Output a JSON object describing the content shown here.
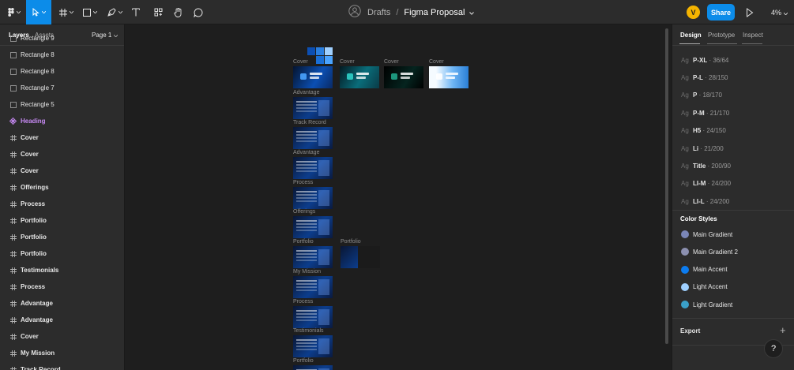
{
  "toolbar": {
    "file_title": "Figma Proposal",
    "location": "Drafts",
    "separator": "/",
    "user_initial": "V",
    "share_label": "Share",
    "zoom": "4%"
  },
  "left_panel": {
    "tabs": [
      "Layers",
      "Assets"
    ],
    "page": "Page 1",
    "layers": [
      {
        "name": "Rectangle 9",
        "kind": "rect"
      },
      {
        "name": "Rectangle 8",
        "kind": "rect"
      },
      {
        "name": "Rectangle 8",
        "kind": "rect"
      },
      {
        "name": "Rectangle 7",
        "kind": "rect"
      },
      {
        "name": "Rectangle 5",
        "kind": "rect"
      },
      {
        "name": "Heading",
        "kind": "component"
      },
      {
        "name": "Cover",
        "kind": "frame"
      },
      {
        "name": "Cover",
        "kind": "frame"
      },
      {
        "name": "Cover",
        "kind": "frame"
      },
      {
        "name": "Offerings",
        "kind": "frame"
      },
      {
        "name": "Process",
        "kind": "frame"
      },
      {
        "name": "Portfolio",
        "kind": "frame"
      },
      {
        "name": "Portfolio",
        "kind": "frame"
      },
      {
        "name": "Portfolio",
        "kind": "frame"
      },
      {
        "name": "Testimonials",
        "kind": "frame"
      },
      {
        "name": "Process",
        "kind": "frame"
      },
      {
        "name": "Advantage",
        "kind": "frame"
      },
      {
        "name": "Advantage",
        "kind": "frame"
      },
      {
        "name": "Cover",
        "kind": "frame"
      },
      {
        "name": "My Mission",
        "kind": "frame"
      },
      {
        "name": "Track Record",
        "kind": "frame"
      }
    ]
  },
  "canvas": {
    "frames": [
      {
        "label": "Cover",
        "style": "t-cover1"
      },
      {
        "label": "Cover",
        "style": "t-cover2"
      },
      {
        "label": "Cover",
        "style": "t-cover3"
      },
      {
        "label": "Cover",
        "style": "t-cover4"
      },
      {
        "label": "Advantage",
        "style": "t-dark"
      },
      {
        "label": "Track Record",
        "style": "t-dark"
      },
      {
        "label": "Advantage",
        "style": "t-dark"
      },
      {
        "label": "Process",
        "style": "t-dark"
      },
      {
        "label": "Offerings",
        "style": "t-dark"
      },
      {
        "label": "Portfolio",
        "style": "t-dark"
      },
      {
        "label": "Portfolio",
        "style": "t-grid"
      },
      {
        "label": "My Mission",
        "style": "t-dark"
      },
      {
        "label": "Process",
        "style": "t-dark"
      },
      {
        "label": "Testimonials",
        "style": "t-dark"
      },
      {
        "label": "Portfolio",
        "style": "t-dark"
      }
    ]
  },
  "right_panel": {
    "tabs": [
      "Design",
      "Prototype",
      "Inspect"
    ],
    "text_styles": [
      {
        "name": "P-XL",
        "spec": "36/64"
      },
      {
        "name": "P-L",
        "spec": "28/150"
      },
      {
        "name": "P",
        "spec": "18/170"
      },
      {
        "name": "P-M",
        "spec": "21/170"
      },
      {
        "name": "H5",
        "spec": "24/150"
      },
      {
        "name": "Li",
        "spec": "21/200"
      },
      {
        "name": "Title",
        "spec": "200/90"
      },
      {
        "name": "LI-M",
        "spec": "24/200"
      },
      {
        "name": "LI-L",
        "spec": "24/200"
      }
    ],
    "text_style_glyph": "Ag",
    "color_styles_title": "Color Styles",
    "color_styles": [
      {
        "name": "Main Gradient",
        "color": "#7a86b8"
      },
      {
        "name": "Main Gradient 2",
        "color": "#8c90b0"
      },
      {
        "name": "Main Accent",
        "color": "#0c7cf0"
      },
      {
        "name": "Light Accent",
        "color": "#9fd0ff"
      },
      {
        "name": "Light Gradient",
        "color": "#3aa0c8"
      }
    ],
    "export_label": "Export",
    "help_label": "?"
  },
  "colors": {
    "accent": "#0c8ce9",
    "panel": "#2c2c2c",
    "canvas": "#1e1e1e",
    "component": "#c88af5"
  }
}
